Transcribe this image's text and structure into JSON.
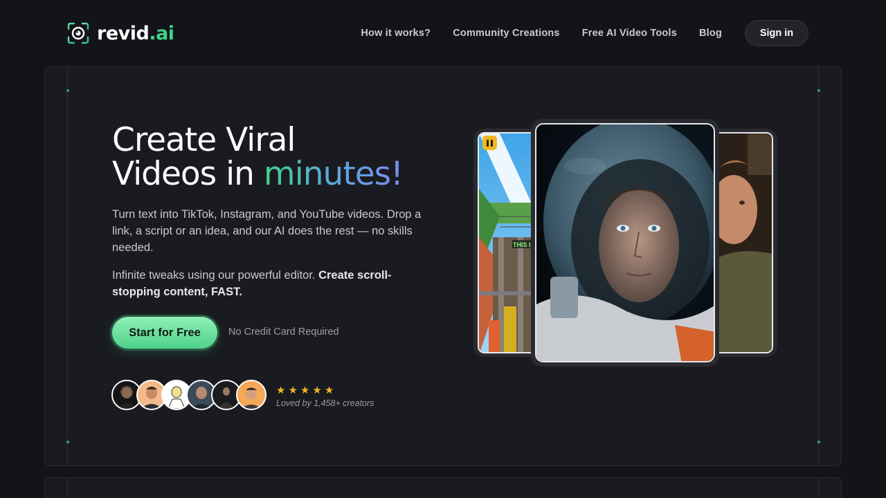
{
  "brand": {
    "name_main": "revid",
    "name_accent": ".ai",
    "logo_icon": "eye-camera-icon"
  },
  "nav": {
    "links": [
      "How it works?",
      "Community Creations",
      "Free AI Video Tools",
      "Blog"
    ],
    "signin_label": "Sign in"
  },
  "hero": {
    "headline_line1": "Create Viral",
    "headline_line2_prefix": "Videos in ",
    "headline_highlight": "minutes!",
    "paragraph1": "Turn text into TikTok, Instagram, and YouTube videos. Drop a link, a script or an idea, and our AI does the rest — no skills needed.",
    "paragraph2_plain": "Infinite tweaks using our powerful editor. ",
    "paragraph2_bold": "Create scroll-stopping content, FAST.",
    "cta_label": "Start for Free",
    "cta_note": "No Credit Card Required",
    "rating_stars": 5,
    "social_proof": "Loved by 1,458+ creators",
    "game_overlay_text": "THIS IS"
  },
  "colors": {
    "accent": "#3fd48a",
    "gradient_end": "#7b8bf0",
    "star": "#f4b524",
    "background": "#131419"
  }
}
